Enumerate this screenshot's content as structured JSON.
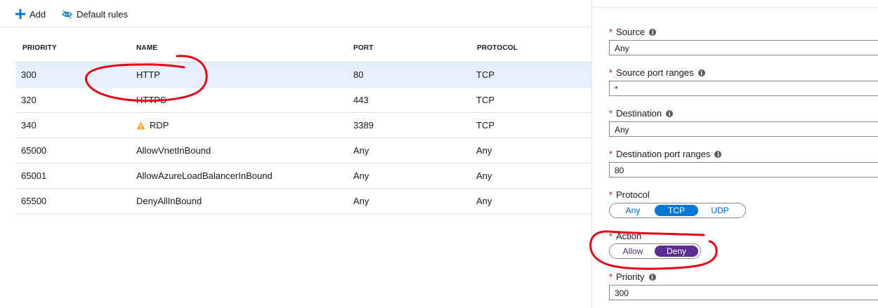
{
  "toolbar": {
    "add_label": "Add",
    "default_rules_label": "Default rules"
  },
  "table": {
    "headers": {
      "priority": "PRIORITY",
      "name": "NAME",
      "port": "PORT",
      "protocol": "PROTOCOL"
    },
    "rows": [
      {
        "priority": "300",
        "name": "HTTP",
        "port": "80",
        "protocol": "TCP",
        "selected": true,
        "warning": false
      },
      {
        "priority": "320",
        "name": "HTTPS",
        "port": "443",
        "protocol": "TCP",
        "selected": false,
        "warning": false
      },
      {
        "priority": "340",
        "name": "RDP",
        "port": "3389",
        "protocol": "TCP",
        "selected": false,
        "warning": true
      },
      {
        "priority": "65000",
        "name": "AllowVnetInBound",
        "port": "Any",
        "protocol": "Any",
        "selected": false,
        "warning": false
      },
      {
        "priority": "65001",
        "name": "AllowAzureLoadBalancerInBound",
        "port": "Any",
        "protocol": "Any",
        "selected": false,
        "warning": false
      },
      {
        "priority": "65500",
        "name": "DenyAllInBound",
        "port": "Any",
        "protocol": "Any",
        "selected": false,
        "warning": false
      }
    ]
  },
  "panel": {
    "required_mark": "*",
    "info_glyph": "i",
    "source": {
      "label": "Source",
      "value": "Any"
    },
    "source_port_ranges": {
      "label": "Source port ranges",
      "value": "*"
    },
    "destination": {
      "label": "Destination",
      "value": "Any"
    },
    "destination_port_ranges": {
      "label": "Destination port ranges",
      "value": "80"
    },
    "protocol": {
      "label": "Protocol",
      "options": [
        "Any",
        "TCP",
        "UDP"
      ],
      "selected": "TCP"
    },
    "action": {
      "label": "Action",
      "options": [
        "Allow",
        "Deny"
      ],
      "selected": "Deny"
    },
    "priority": {
      "label": "Priority",
      "value": "300"
    }
  },
  "colors": {
    "accent_blue": "#0078d4",
    "deny_purple": "#5c2d91",
    "annotation_red": "#e3001b",
    "warning_orange": "#f5a623",
    "selected_row": "#e6f0fb"
  },
  "icons": {
    "add": "plus-icon",
    "default_rules": "eye-slash-icon",
    "warning": "warning-icon",
    "info": "info-icon"
  }
}
